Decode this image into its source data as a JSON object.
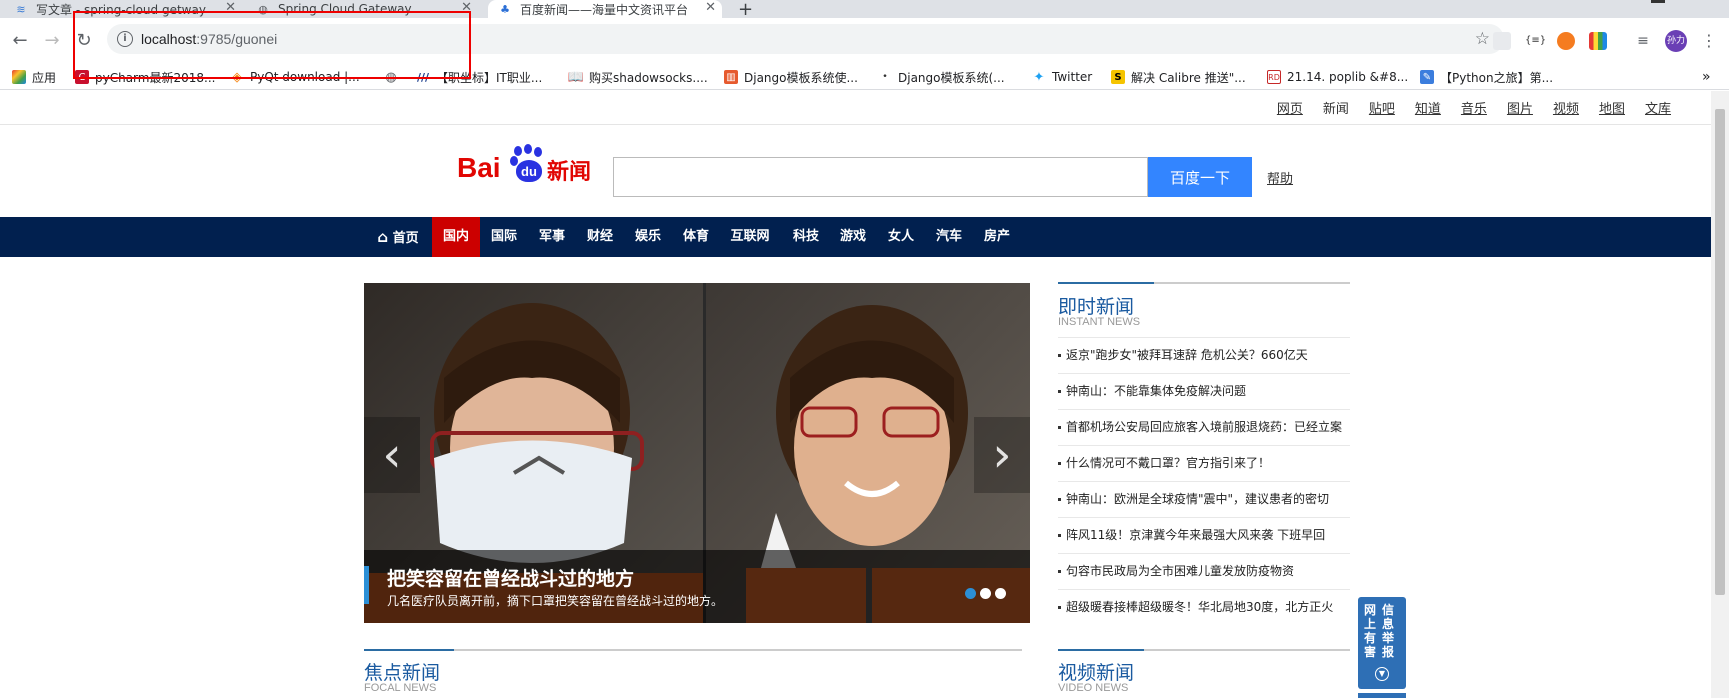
{
  "browser": {
    "tabs": [
      {
        "title": "写文章 - spring-cloud getway"
      },
      {
        "title": "Spring Cloud Gateway"
      },
      {
        "title": "百度新闻——海量中文资讯平台"
      }
    ],
    "new_tab": "+",
    "url_host": "localhost",
    "url_path": ":9785/guonei",
    "profile_label": "孙力",
    "bookmarks": [
      "应用",
      "pyCharm最新2018...",
      "PyQt download |...",
      "【职坐标】IT职业...",
      "购买shadowsocks....",
      "Django模板系统使...",
      "Django模板系统(...",
      "Twitter",
      "解决 Calibre 推送\"...",
      "21.14. poplib &#8...",
      "【Python之旅】第..."
    ],
    "bookmarks_more": "»"
  },
  "page": {
    "top_links": [
      "网页",
      "新闻",
      "贴吧",
      "知道",
      "音乐",
      "图片",
      "视频",
      "地图",
      "文库"
    ],
    "logo": {
      "brand": "Bai",
      "paw_text": "du",
      "suffix": "新闻"
    },
    "search_button": "百度一下",
    "help": "帮助",
    "nav": [
      "首页",
      "国内",
      "国际",
      "军事",
      "财经",
      "娱乐",
      "体育",
      "互联网",
      "科技",
      "游戏",
      "女人",
      "汽车",
      "房产"
    ],
    "slider": {
      "title": "把笑容留在曾经战斗过的地方",
      "subtitle": "几名医疗队员离开前，摘下口罩把笑容留在曾经战斗过的地方。",
      "slides": 3,
      "active": 1
    },
    "instant_news": {
      "title": "即时新闻",
      "subtitle": "INSTANT NEWS",
      "items": [
        "返京\"跑步女\"被拜耳速辞 危机公关？660亿天",
        "钟南山：不能靠集体免疫解决问题",
        "首都机场公安局回应旅客入境前服退烧药：已经立案",
        "什么情况可不戴口罩？官方指引来了！",
        "钟南山：欧洲是全球疫情\"震中\"，建议患者的密切",
        "阵风11级！京津冀今年来最强大风来袭 下班早回",
        "句容市民政局为全市困难儿童发放防疫物资",
        "超级暖春接棒超级暖冬！华北局地30度，北方正火"
      ]
    },
    "focus_news": {
      "title": "焦点新闻",
      "subtitle": "FOCAL NEWS"
    },
    "video_news": {
      "title": "视频新闻",
      "subtitle": "VIDEO NEWS"
    },
    "report_widget": {
      "chars": [
        "网",
        "上",
        "有",
        "害",
        "信",
        "息",
        "举",
        "报"
      ]
    }
  }
}
